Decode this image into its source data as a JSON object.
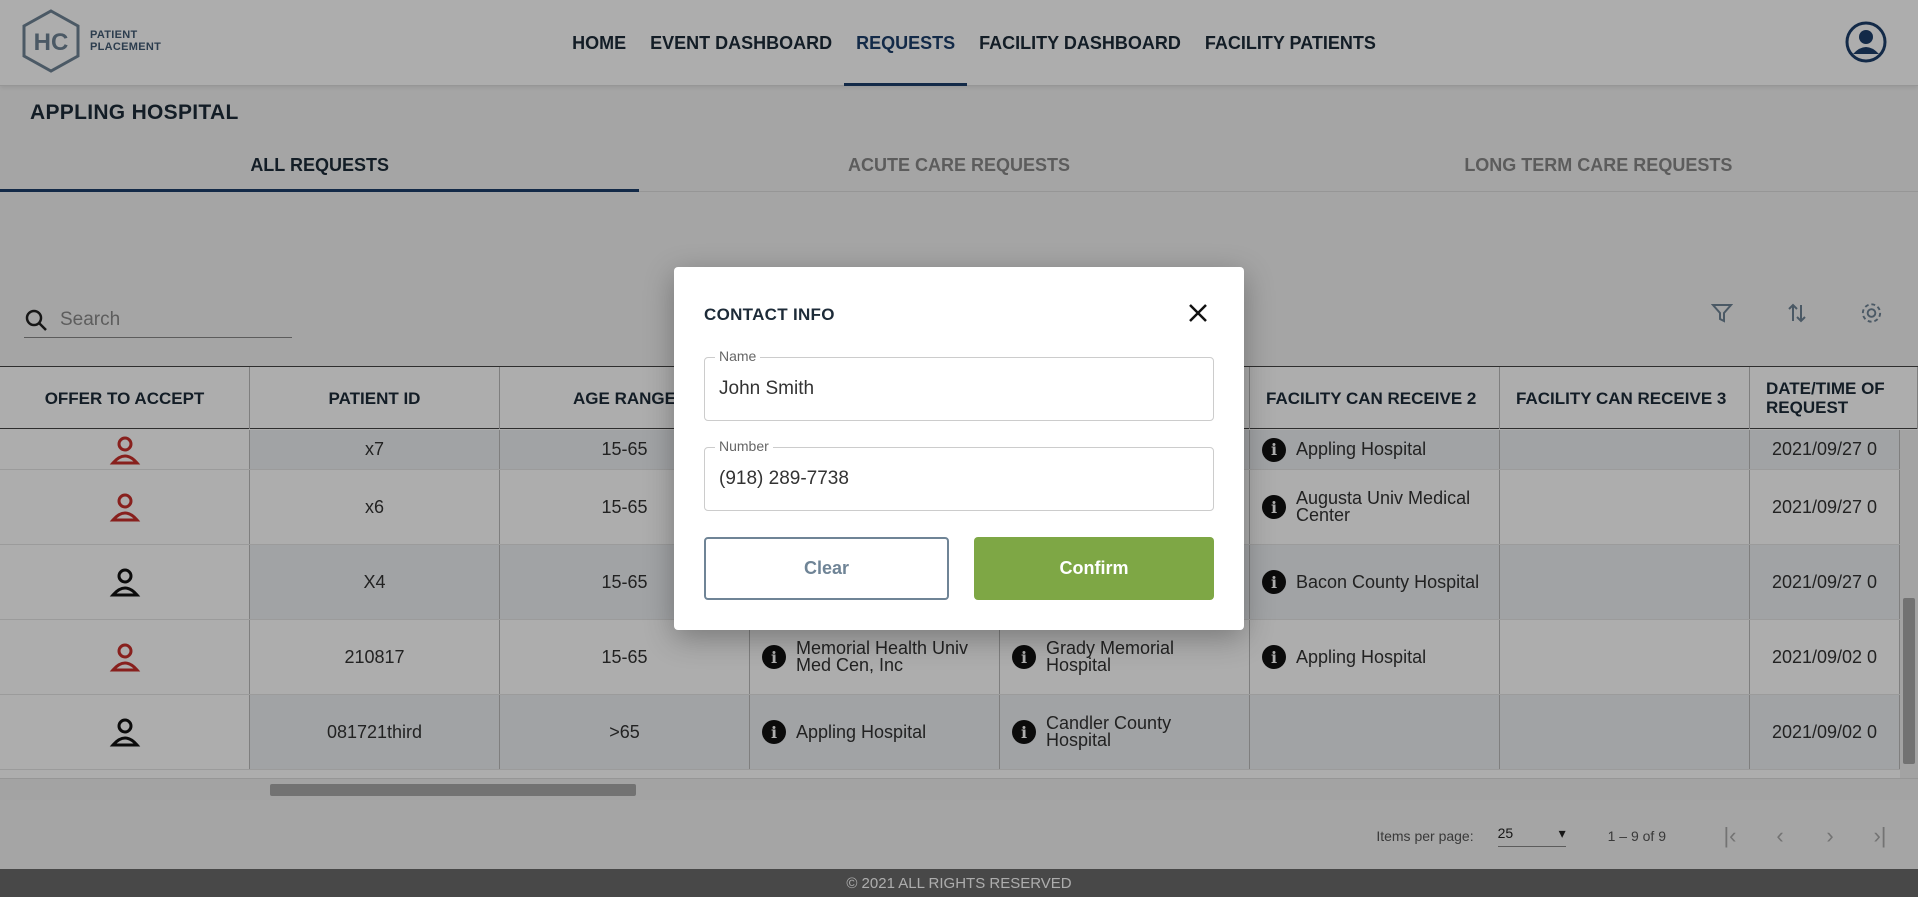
{
  "app": {
    "logo_mark": "HC",
    "logo_line1": "PATIENT",
    "logo_line2": "PLACEMENT"
  },
  "nav": {
    "items": [
      {
        "label": "HOME",
        "active": false
      },
      {
        "label": "EVENT DASHBOARD",
        "active": false
      },
      {
        "label": "REQUESTS",
        "active": true
      },
      {
        "label": "FACILITY DASHBOARD",
        "active": false
      },
      {
        "label": "FACILITY PATIENTS",
        "active": false
      }
    ]
  },
  "page": {
    "hospital": "APPLING HOSPITAL",
    "tabs": [
      "ALL REQUESTS",
      "ACUTE CARE REQUESTS",
      "LONG TERM CARE REQUESTS"
    ]
  },
  "search": {
    "placeholder": "Search"
  },
  "table": {
    "columns": [
      "OFFER TO ACCEPT",
      "PATIENT ID",
      "AGE RANGE",
      "",
      "",
      "FACILITY CAN RECEIVE 2",
      "FACILITY CAN RECEIVE 3",
      "DATE/TIME OF REQUEST"
    ],
    "rows": [
      {
        "offer": "red",
        "id": "x7",
        "age": "15-65",
        "fac0": "",
        "fac1": "",
        "fac2": "Appling Hospital",
        "fac3": "",
        "date": "2021/09/27 0"
      },
      {
        "offer": "red",
        "id": "x6",
        "age": "15-65",
        "fac0": "",
        "fac1": "",
        "fac2": "Augusta Univ Medical Center",
        "fac3": "",
        "date": "2021/09/27 0"
      },
      {
        "offer": "black",
        "id": "X4",
        "age": "15-65",
        "fac0": "",
        "fac1": "",
        "fac2": "Bacon County Hospital",
        "fac3": "",
        "date": "2021/09/27 0"
      },
      {
        "offer": "red",
        "id": "210817",
        "age": "15-65",
        "fac0": "Memorial Health Univ Med Cen, Inc",
        "fac1": "Grady Memorial Hospital",
        "fac2": "Appling Hospital",
        "fac3": "",
        "date": "2021/09/02 0"
      },
      {
        "offer": "black",
        "id": "081721third",
        "age": ">65",
        "fac0": "Appling Hospital",
        "fac1": "Candler County Hospital",
        "fac2": "",
        "fac3": "",
        "date": "2021/09/02 0"
      }
    ]
  },
  "paginator": {
    "label": "Items per page:",
    "page_size": "25",
    "range": "1 – 9 of 9"
  },
  "footer": {
    "text": "© 2021 ALL RIGHTS RESERVED"
  },
  "modal": {
    "title": "CONTACT INFO",
    "name_label": "Name",
    "name_value": "John Smith",
    "number_label": "Number",
    "number_value": "(918) 289-7738",
    "clear_label": "Clear",
    "confirm_label": "Confirm"
  },
  "colors": {
    "accent": "#1d3f6b",
    "confirm": "#7ea745",
    "offer_red": "#c9302c"
  }
}
